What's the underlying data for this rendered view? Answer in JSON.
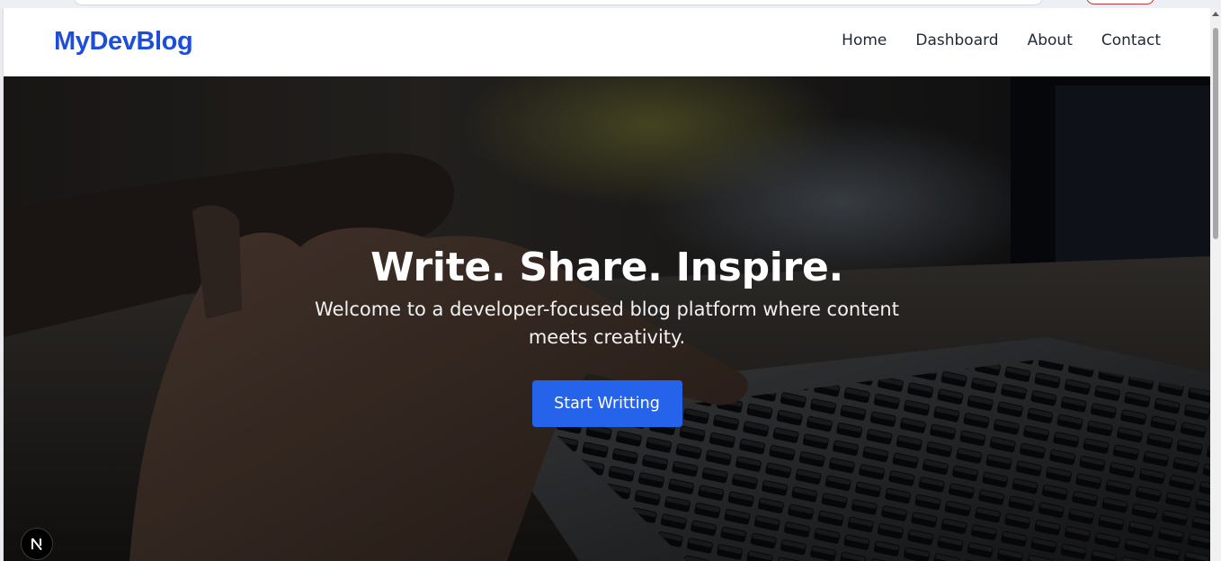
{
  "brand": {
    "name": "MyDevBlog",
    "color": "#1d4ed8"
  },
  "nav": {
    "items": [
      "Home",
      "Dashboard",
      "About",
      "Contact"
    ]
  },
  "hero": {
    "title": "Write. Share. Inspire.",
    "subtitle": "Welcome to a developer-focused blog platform where content meets creativity.",
    "cta_label": "Start Writting",
    "cta_color": "#2563eb",
    "background_icon": "hands-typing-on-laptop-photo"
  },
  "badge": {
    "icon": "nextjs-logo-icon"
  }
}
